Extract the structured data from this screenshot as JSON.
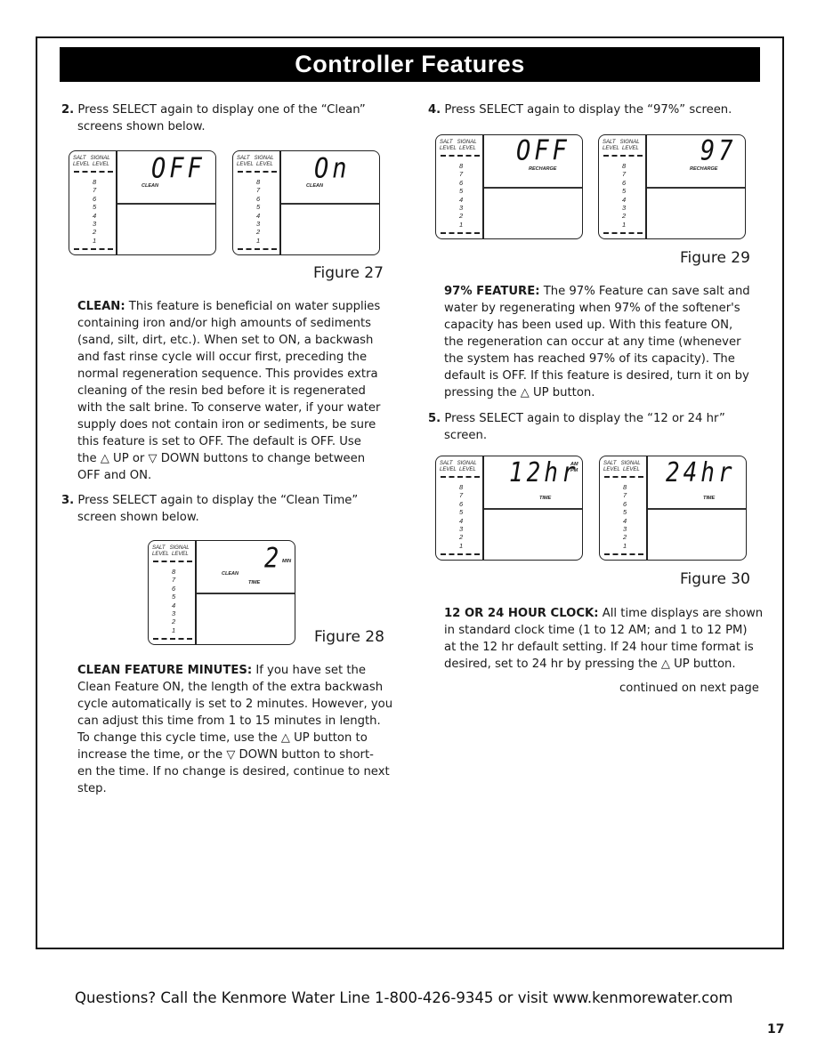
{
  "page": {
    "title": "Controller Features",
    "page_number": "17",
    "footer": "Questions? Call the Kenmore Water Line 1-800-426-9345 or visit www.kenmorewater.com"
  },
  "left": {
    "step2": {
      "number": "2.",
      "text_line1": "Press SELECT again to display one of the “Clean”",
      "text_line2": "screens shown below."
    },
    "figure27_caption": "Figure 27",
    "clean_para": {
      "heading": "CLEAN:",
      "lines": [
        " This feature is beneficial on water supplies",
        "containing iron and/or high amounts of sediments",
        "(sand, silt, dirt, etc.).  When set to ON, a backwash",
        "and fast rinse cycle will occur first, preceding the",
        "normal regeneration sequence.  This provides extra",
        "cleaning of the resin bed before it is regenerated",
        "with the salt brine.  To conserve water, if your water",
        "supply does not contain iron or sediments, be sure",
        "this feature is set to OFF.  The default is OFF.  Use"
      ],
      "line10_a": "the ",
      "up_icon": "△",
      "line10_b": " UP or ",
      "down_icon": "▽",
      "line10_c": " DOWN buttons to change between",
      "line11": "OFF and ON."
    },
    "step3": {
      "number": "3.",
      "text_line1": "Press SELECT again to display the “Clean Time”",
      "text_line2": "screen shown below."
    },
    "figure28_caption": "Figure 28",
    "minutes_para": {
      "heading": "CLEAN FEATURE MINUTES:",
      "line1_rest": " If you have set the",
      "lines": [
        "Clean Feature ON, the length of the extra backwash",
        "cycle automatically is set to 2 minutes.  However, you",
        "can adjust this time from 1 to 15 minutes in length."
      ],
      "line5_a": "To change this cycle time, use the ",
      "up_icon": "△",
      "line5_b": " UP button to",
      "line6_a": "increase the time, or the ",
      "down_icon": "▽",
      "line6_b": " DOWN button to short-",
      "line7": "en the time.  If no change is desired, continue to next",
      "line8": "step."
    }
  },
  "right": {
    "step4": {
      "number": "4.",
      "text": "Press SELECT again to display the “97%” screen."
    },
    "figure29_caption": "Figure 29",
    "feature97_para": {
      "heading": "97% FEATURE:",
      "line1_rest": " The 97% Feature can save salt and",
      "lines": [
        "water by regenerating when 97% of the softener's",
        "capacity has been used up.  With this feature ON,",
        "the regeneration can occur at any time (whenever",
        "the system has reached 97% of its capacity).  The",
        "default is OFF.  If this feature is desired, turn it on by"
      ],
      "line7_a": "pressing the ",
      "up_icon": "△",
      "line7_b": " UP button."
    },
    "step5": {
      "number": "5.",
      "text_line1": "Press SELECT again to display the “12 or 24 hr”",
      "text_line2": "screen."
    },
    "figure30_caption": "Figure 30",
    "clock_para": {
      "heading": "12 OR 24 HOUR CLOCK:",
      "line1_rest": " All time displays are shown",
      "lines": [
        "in standard clock time (1 to 12 AM; and 1 to 12 PM)",
        "at the 12 hr default setting.  If 24 hour time format is"
      ],
      "line4_a": "desired, set to 24 hr by pressing the ",
      "up_icon": "△",
      "line4_b": " UP button."
    },
    "continued": "continued on next page"
  },
  "lcd_common": {
    "salt": "SALT",
    "signal": "SIGNAL",
    "level": "LEVEL",
    "levels": [
      "8",
      "7",
      "6",
      "5",
      "4",
      "3",
      "2",
      "1"
    ]
  },
  "displays": {
    "fig27a": {
      "main": "OFF",
      "label": "CLEAN"
    },
    "fig27b": {
      "main": "On",
      "label": "CLEAN"
    },
    "fig28": {
      "main": "2",
      "unit": "MIN",
      "label": "CLEAN",
      "label2": "TIME"
    },
    "fig29a": {
      "main": "OFF",
      "label": "RECHARGE"
    },
    "fig29b": {
      "main": "97",
      "label": "RECHARGE"
    },
    "fig30a": {
      "main": "12hr",
      "am": "AM",
      "pm": "PM",
      "label": "TIME"
    },
    "fig30b": {
      "main": "24hr",
      "label": "TIME"
    }
  }
}
